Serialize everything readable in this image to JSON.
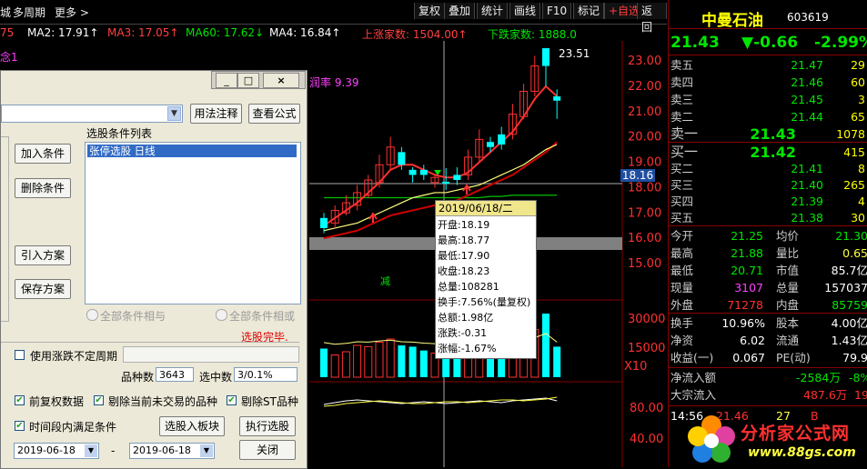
{
  "topbar": {
    "menu": [
      "城",
      "多周期",
      "更多 >"
    ],
    "buttons": [
      "复权",
      "叠加",
      "统计",
      "画线",
      "F10",
      "标记",
      "+自选",
      "返回"
    ]
  },
  "ma_row": {
    "items": [
      "75",
      "MA2: 17.91↑",
      "MA3: 17.05↑",
      "MA60: 17.62↓",
      "MA4: 16.84↑",
      "上涨家数: 1504.00↑",
      "下跌家数: 1888.0"
    ],
    "colors": [
      "#ff4040",
      "#ffffff",
      "#ff4040",
      "#00e600",
      "#ffffff",
      "#ff4040",
      "#00e600"
    ]
  },
  "chart": {
    "overlay_text_1": "念1",
    "overlay_text_2": "润率 9.39",
    "price_labels": [
      "23.00",
      "22.00",
      "21.00",
      "20.00",
      "19.00",
      "18.00",
      "17.00",
      "16.00",
      "15.00"
    ],
    "vol_labels": [
      "30000",
      "15000",
      "X10"
    ],
    "ind_labels": [
      "80.00",
      "40.00"
    ],
    "current_price_tag": "18.16",
    "high_mark": "23.51",
    "signal_mark": "减"
  },
  "chart_data": {
    "type": "candlestick",
    "candles": [
      {
        "o": 16.4,
        "c": 16.8,
        "h": 17.0,
        "l": 16.2,
        "up": false
      },
      {
        "o": 16.6,
        "c": 17.1,
        "h": 17.3,
        "l": 16.4,
        "up": true
      },
      {
        "o": 17.0,
        "c": 17.4,
        "h": 17.7,
        "l": 16.9,
        "up": true
      },
      {
        "o": 17.3,
        "c": 17.8,
        "h": 18.1,
        "l": 17.1,
        "up": true
      },
      {
        "o": 17.7,
        "c": 18.3,
        "h": 18.5,
        "l": 17.6,
        "up": true
      },
      {
        "o": 18.2,
        "c": 18.9,
        "h": 19.3,
        "l": 18.0,
        "up": true
      },
      {
        "o": 18.9,
        "c": 19.6,
        "h": 20.0,
        "l": 18.7,
        "up": true
      },
      {
        "o": 19.4,
        "c": 18.9,
        "h": 19.6,
        "l": 18.7,
        "up": false
      },
      {
        "o": 18.7,
        "c": 18.5,
        "h": 18.8,
        "l": 18.2,
        "up": false
      },
      {
        "o": 18.5,
        "c": 18.7,
        "h": 18.9,
        "l": 18.3,
        "up": false
      },
      {
        "o": 18.2,
        "c": 18.4,
        "h": 18.5,
        "l": 18.0,
        "up": true
      },
      {
        "o": 18.19,
        "c": 18.23,
        "h": 18.77,
        "l": 17.9,
        "up": false
      },
      {
        "o": 18.3,
        "c": 18.5,
        "h": 18.8,
        "l": 18.1,
        "up": false
      },
      {
        "o": 18.5,
        "c": 19.2,
        "h": 19.5,
        "l": 18.3,
        "up": true
      },
      {
        "o": 19.2,
        "c": 19.9,
        "h": 20.3,
        "l": 19.0,
        "up": true
      },
      {
        "o": 19.8,
        "c": 19.6,
        "h": 20.0,
        "l": 19.4,
        "up": false
      },
      {
        "o": 19.7,
        "c": 20.1,
        "h": 20.4,
        "l": 19.5,
        "up": false
      },
      {
        "o": 20.1,
        "c": 20.9,
        "h": 21.3,
        "l": 19.9,
        "up": true
      },
      {
        "o": 20.8,
        "c": 21.8,
        "h": 22.1,
        "l": 20.7,
        "up": true
      },
      {
        "o": 21.8,
        "c": 22.8,
        "h": 23.2,
        "l": 21.6,
        "up": true
      },
      {
        "o": 22.8,
        "c": 23.5,
        "h": 23.51,
        "l": 22.0,
        "up": false
      },
      {
        "o": 21.6,
        "c": 21.43,
        "h": 21.88,
        "l": 20.71,
        "up": false
      }
    ],
    "volumes": [
      0.45,
      0.35,
      0.4,
      0.5,
      0.48,
      0.55,
      0.6,
      0.5,
      0.48,
      0.42,
      0.38,
      0.45,
      0.35,
      0.55,
      0.5,
      0.45,
      0.58,
      0.7,
      0.8,
      0.75,
      1.0,
      0.48
    ],
    "volume_up": [
      false,
      true,
      true,
      true,
      true,
      true,
      true,
      false,
      false,
      false,
      true,
      false,
      false,
      true,
      true,
      false,
      false,
      true,
      true,
      true,
      false,
      false
    ],
    "ylim": [
      15.0,
      23.5
    ],
    "ma_fast": [
      16.5,
      16.8,
      17.1,
      17.4,
      17.8,
      18.2,
      18.7,
      18.9,
      18.9,
      18.7,
      18.5,
      18.4,
      18.4,
      18.6,
      19.0,
      19.4,
      19.8,
      20.2,
      20.8,
      21.5,
      22.0,
      21.6
    ],
    "ma_slow": [
      16.3,
      16.4,
      16.5,
      16.6,
      16.8,
      17.0,
      17.2,
      17.4,
      17.6,
      17.7,
      17.8,
      17.8,
      17.9,
      18.0,
      18.1,
      18.3,
      18.5,
      18.7,
      18.9,
      19.2,
      19.5,
      19.7
    ],
    "ma_mid": [
      16.0,
      16.1,
      16.2,
      16.3,
      16.5,
      16.7,
      16.9,
      17.0,
      17.1,
      17.2,
      17.3,
      17.4,
      17.5,
      17.7,
      17.9,
      18.1,
      18.3,
      18.5,
      18.8,
      19.1,
      19.4,
      19.8
    ],
    "ma_long": [
      17.6,
      17.6,
      17.6,
      17.6,
      17.6,
      17.6,
      17.6,
      17.6,
      17.6,
      17.6,
      17.6,
      17.6,
      17.6,
      17.6,
      17.6,
      17.65,
      17.65,
      17.7,
      17.7,
      17.7,
      17.7,
      17.7
    ]
  },
  "tooltip": {
    "date": "2019/06/18/二",
    "lines": [
      "开盘:18.19",
      "最高:18.77",
      "最低:17.90",
      "收盘:18.23",
      "总量:108281",
      "换手:7.56%(量复权)",
      "总额:1.98亿",
      "涨跌:-0.31",
      "涨幅:-1.67%"
    ]
  },
  "dialog": {
    "formula_select": "",
    "usage_btn": "用法注释",
    "view_formula_btn": "查看公式",
    "list_title": "选股条件列表",
    "list_items": [
      "张停选股  日线"
    ],
    "add_btn": "加入条件",
    "delete_btn": "删除条件",
    "import_btn": "引入方案",
    "save_btn": "保存方案",
    "radio_and": "全部条件相与",
    "radio_or": "全部条件相或",
    "status": "选股完毕.",
    "use_variable_period": "使用涨跌不定周期",
    "stock_count_label": "品种数",
    "stock_count": "3643",
    "selected_label": "选中数",
    "selected_value": "3/0.1%",
    "check_fq": "前复权数据",
    "check_exclude_untraded": "剔除当前未交易的品种",
    "check_exclude_st": "剔除ST品种",
    "check_period": "时间段内满足条件",
    "select_to_block_btn": "选股入板块",
    "execute_btn": "执行选股",
    "date_from": "2019-06-18",
    "date_sep": "-",
    "date_to": "2019-06-18",
    "close_btn": "关闭",
    "win_controls": [
      "_",
      "□",
      "×"
    ]
  },
  "quote": {
    "name": "中曼石油",
    "code": "603619",
    "price": "21.43",
    "change": "▼-0.66",
    "change_pct": "-2.99%",
    "asks": [
      {
        "label": "卖五",
        "price": "21.47",
        "vol": "29"
      },
      {
        "label": "卖四",
        "price": "21.46",
        "vol": "60"
      },
      {
        "label": "卖三",
        "price": "21.45",
        "vol": "3"
      },
      {
        "label": "卖二",
        "price": "21.44",
        "vol": "65"
      },
      {
        "label": "卖一",
        "price": "21.43",
        "vol": "1078"
      }
    ],
    "bids": [
      {
        "label": "买一",
        "price": "21.42",
        "vol": "415"
      },
      {
        "label": "买二",
        "price": "21.41",
        "vol": "8"
      },
      {
        "label": "买三",
        "price": "21.40",
        "vol": "265"
      },
      {
        "label": "买四",
        "price": "21.39",
        "vol": "4"
      },
      {
        "label": "买五",
        "price": "21.38",
        "vol": "30"
      }
    ],
    "stats": [
      {
        "l1": "今开",
        "v1": "21.25",
        "c1": "green",
        "l2": "均价",
        "v2": "21.30",
        "c2": "green"
      },
      {
        "l1": "最高",
        "v1": "21.88",
        "c1": "green",
        "l2": "量比",
        "v2": "0.65",
        "c2": "yellow"
      },
      {
        "l1": "最低",
        "v1": "20.71",
        "c1": "green",
        "l2": "市值",
        "v2": "85.7亿",
        "c2": "white"
      },
      {
        "l1": "现量",
        "v1": "3107",
        "c1": "magenta",
        "l2": "总量",
        "v2": "157037",
        "c2": "white"
      },
      {
        "l1": "外盘",
        "v1": "71278",
        "c1": "red",
        "l2": "内盘",
        "v2": "85759",
        "c2": "green"
      }
    ],
    "stats2": [
      {
        "l1": "换手",
        "v1": "10.96%",
        "c1": "white",
        "l2": "股本",
        "v2": "4.00亿",
        "c2": "white"
      },
      {
        "l1": "净资",
        "v1": "6.02",
        "c1": "white",
        "l2": "流通",
        "v2": "1.43亿",
        "c2": "white"
      },
      {
        "l1": "收益(一)",
        "v1": "0.067",
        "c1": "white",
        "l2": "PE(动)",
        "v2": "79.9",
        "c2": "white"
      }
    ],
    "netflow_label": "净流入额",
    "netflow_value": "-2584万",
    "netflow_tail": "-8%",
    "block_label": "大宗流入",
    "block_value": "487.6万",
    "block_tail": "19%",
    "tick_time": "14:56",
    "tick_price": "21.46",
    "tick_vol": "27",
    "tick_flag": "B"
  },
  "watermark": {
    "text": "分析家公式网",
    "url": "www.88gs.com"
  }
}
